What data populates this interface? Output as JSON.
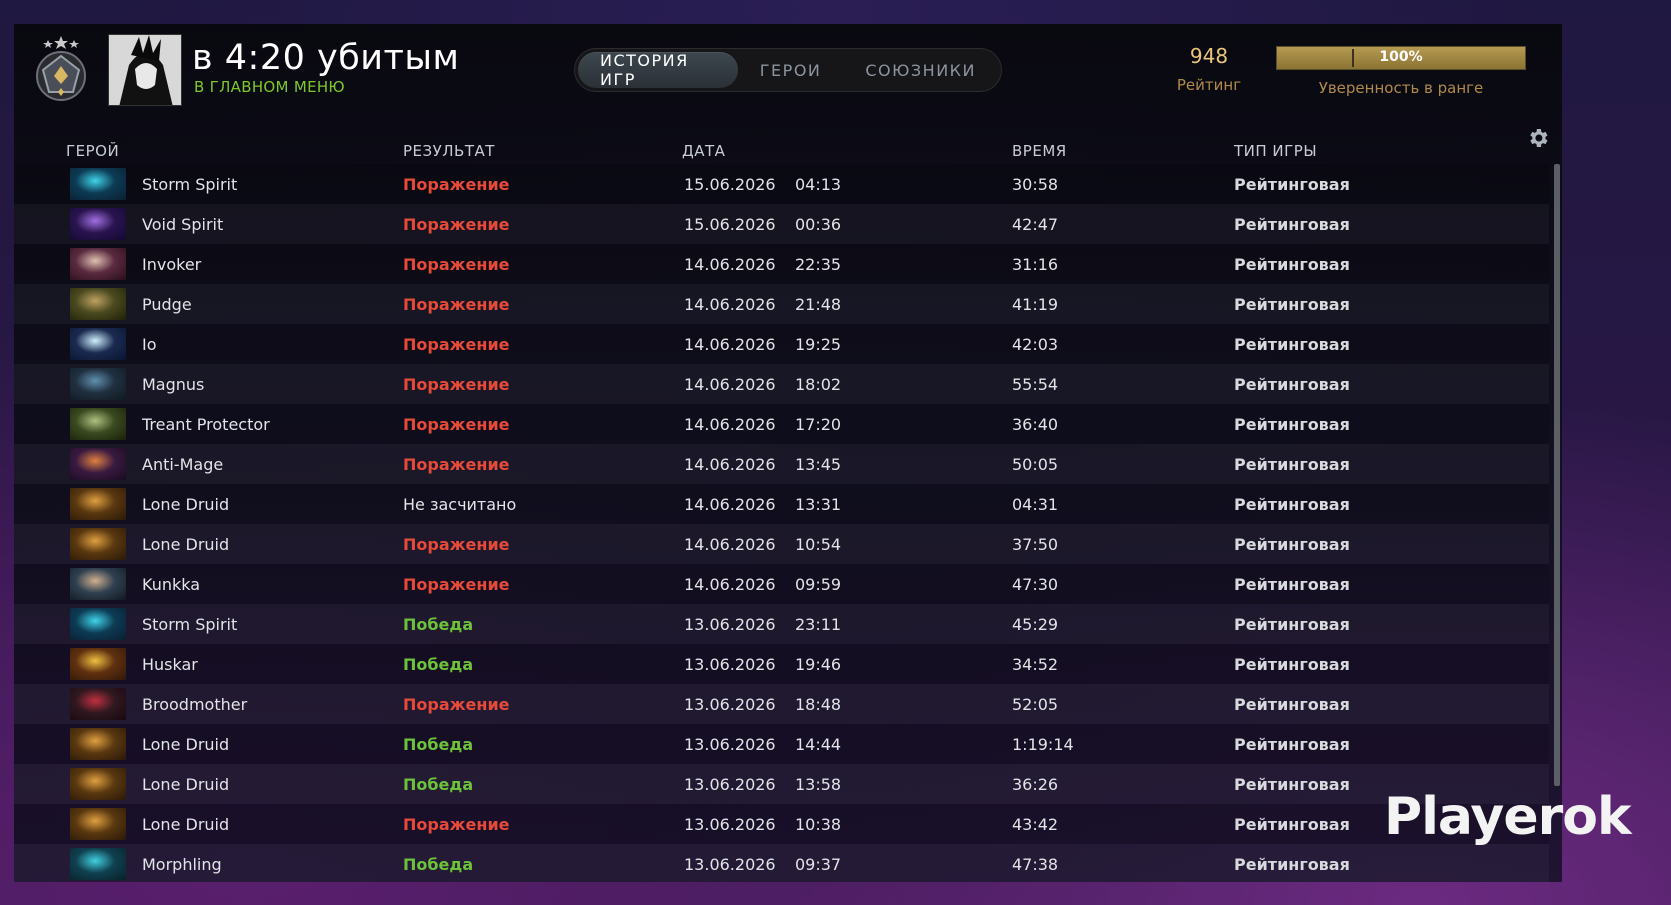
{
  "header": {
    "player_name": "в 4:20 убитым",
    "player_status": "В ГЛАВНОМ МЕНЮ",
    "rating_value": "948",
    "rating_label": "Рейтинг",
    "confidence_value": "100%",
    "confidence_fraction": 1.0,
    "confidence_label": "Уверенность в ранге"
  },
  "tabs": [
    {
      "label": "ИСТОРИЯ ИГР",
      "active": true
    },
    {
      "label": "ГЕРОИ",
      "active": false
    },
    {
      "label": "СОЮЗНИКИ",
      "active": false
    }
  ],
  "columns": {
    "hero": "ГЕРОЙ",
    "result": "РЕЗУЛЬТАТ",
    "date": "ДАТА",
    "duration": "ВРЕМЯ",
    "game_type": "ТИП ИГРЫ"
  },
  "colors": {
    "loss": "#e84a3a",
    "win": "#6cc33a",
    "gold": "#e8c77a",
    "status_green": "#7ec82a"
  },
  "matches": [
    {
      "hero": "Storm Spirit",
      "result": "Поражение",
      "outcome": "loss",
      "date": "15.06.2026",
      "time": "04:13",
      "duration": "30:58",
      "type": "Рейтинговая",
      "icon": "storm-spirit"
    },
    {
      "hero": "Void Spirit",
      "result": "Поражение",
      "outcome": "loss",
      "date": "15.06.2026",
      "time": "00:36",
      "duration": "42:47",
      "type": "Рейтинговая",
      "icon": "void-spirit"
    },
    {
      "hero": "Invoker",
      "result": "Поражение",
      "outcome": "loss",
      "date": "14.06.2026",
      "time": "22:35",
      "duration": "31:16",
      "type": "Рейтинговая",
      "icon": "invoker"
    },
    {
      "hero": "Pudge",
      "result": "Поражение",
      "outcome": "loss",
      "date": "14.06.2026",
      "time": "21:48",
      "duration": "41:19",
      "type": "Рейтинговая",
      "icon": "pudge"
    },
    {
      "hero": "Io",
      "result": "Поражение",
      "outcome": "loss",
      "date": "14.06.2026",
      "time": "19:25",
      "duration": "42:03",
      "type": "Рейтинговая",
      "icon": "io"
    },
    {
      "hero": "Magnus",
      "result": "Поражение",
      "outcome": "loss",
      "date": "14.06.2026",
      "time": "18:02",
      "duration": "55:54",
      "type": "Рейтинговая",
      "icon": "magnus"
    },
    {
      "hero": "Treant Protector",
      "result": "Поражение",
      "outcome": "loss",
      "date": "14.06.2026",
      "time": "17:20",
      "duration": "36:40",
      "type": "Рейтинговая",
      "icon": "treant"
    },
    {
      "hero": "Anti-Mage",
      "result": "Поражение",
      "outcome": "loss",
      "date": "14.06.2026",
      "time": "13:45",
      "duration": "50:05",
      "type": "Рейтинговая",
      "icon": "anti-mage"
    },
    {
      "hero": "Lone Druid",
      "result": "Не засчитано",
      "outcome": "neutral",
      "date": "14.06.2026",
      "time": "13:31",
      "duration": "04:31",
      "type": "Рейтинговая",
      "icon": "lone-druid"
    },
    {
      "hero": "Lone Druid",
      "result": "Поражение",
      "outcome": "loss",
      "date": "14.06.2026",
      "time": "10:54",
      "duration": "37:50",
      "type": "Рейтинговая",
      "icon": "lone-druid"
    },
    {
      "hero": "Kunkka",
      "result": "Поражение",
      "outcome": "loss",
      "date": "14.06.2026",
      "time": "09:59",
      "duration": "47:30",
      "type": "Рейтинговая",
      "icon": "kunkka"
    },
    {
      "hero": "Storm Spirit",
      "result": "Победа",
      "outcome": "win",
      "date": "13.06.2026",
      "time": "23:11",
      "duration": "45:29",
      "type": "Рейтинговая",
      "icon": "storm-spirit"
    },
    {
      "hero": "Huskar",
      "result": "Победа",
      "outcome": "win",
      "date": "13.06.2026",
      "time": "19:46",
      "duration": "34:52",
      "type": "Рейтинговая",
      "icon": "huskar"
    },
    {
      "hero": "Broodmother",
      "result": "Поражение",
      "outcome": "loss",
      "date": "13.06.2026",
      "time": "18:48",
      "duration": "52:05",
      "type": "Рейтинговая",
      "icon": "broodmother"
    },
    {
      "hero": "Lone Druid",
      "result": "Победа",
      "outcome": "win",
      "date": "13.06.2026",
      "time": "14:44",
      "duration": "1:19:14",
      "type": "Рейтинговая",
      "icon": "lone-druid"
    },
    {
      "hero": "Lone Druid",
      "result": "Победа",
      "outcome": "win",
      "date": "13.06.2026",
      "time": "13:58",
      "duration": "36:26",
      "type": "Рейтинговая",
      "icon": "lone-druid"
    },
    {
      "hero": "Lone Druid",
      "result": "Поражение",
      "outcome": "loss",
      "date": "13.06.2026",
      "time": "10:38",
      "duration": "43:42",
      "type": "Рейтинговая",
      "icon": "lone-druid"
    },
    {
      "hero": "Morphling",
      "result": "Победа",
      "outcome": "win",
      "date": "13.06.2026",
      "time": "09:37",
      "duration": "47:38",
      "type": "Рейтинговая",
      "icon": "morphling"
    }
  ],
  "watermark": "Playerok"
}
